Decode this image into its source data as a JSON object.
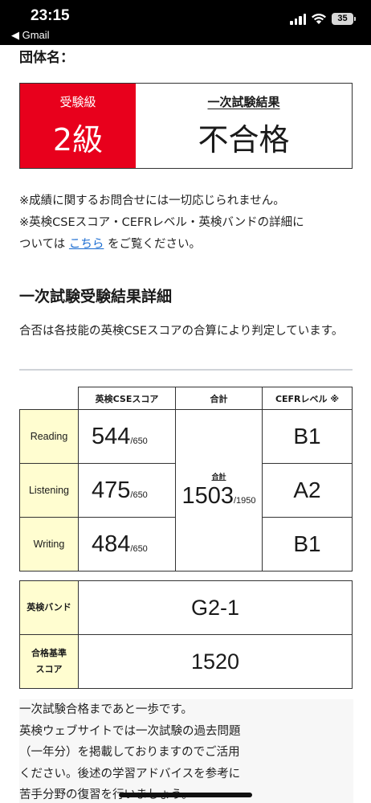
{
  "status_bar": {
    "time": "23:15",
    "back_app": "◀ Gmail",
    "battery": "35"
  },
  "group_label": "団体名：",
  "result": {
    "grade_label": "受験級",
    "grade_value": "2級",
    "result_label": "一次試験結果",
    "result_value": "不合格"
  },
  "notes": {
    "line1": "※成績に関するお問合せには一切応じられません。",
    "line2": "※英検CSEスコア・CEFRレベル・英検バンドの詳細に",
    "line3_before": "ついては ",
    "link_text": "こちら",
    "line3_after": " をご覧ください。"
  },
  "details": {
    "title": "一次試験受験結果詳細",
    "description": "合否は各技能の英検CSEスコアの合算により判定しています。"
  },
  "score_table": {
    "headers": [
      "",
      "英検CSEスコア",
      "合計",
      "CEFRレベル ※"
    ],
    "rows": [
      {
        "skill": "Reading",
        "score": "544",
        "max": "/650",
        "cefr": "B1"
      },
      {
        "skill": "Listening",
        "score": "475",
        "max": "/650",
        "cefr": "A2"
      },
      {
        "skill": "Writing",
        "score": "484",
        "max": "/650",
        "cefr": "B1"
      }
    ],
    "total_caption": "合計",
    "total_score": "1503",
    "total_max": "/1950"
  },
  "band_table": {
    "band_label": "英検バンド",
    "band_value": "G2-1",
    "pass_label_line1": "合格基準",
    "pass_label_line2": "スコア",
    "pass_value": "1520"
  },
  "advice": {
    "lines": [
      "一次試験合格まであと一歩です。",
      "英検ウェブサイトでは一次試験の過去問題",
      "（一年分）を掲載しておりますのでご活用",
      "ください。後述の学習アドバイスを参考に",
      "苦手分野の復習を行いましょう。"
    ]
  }
}
